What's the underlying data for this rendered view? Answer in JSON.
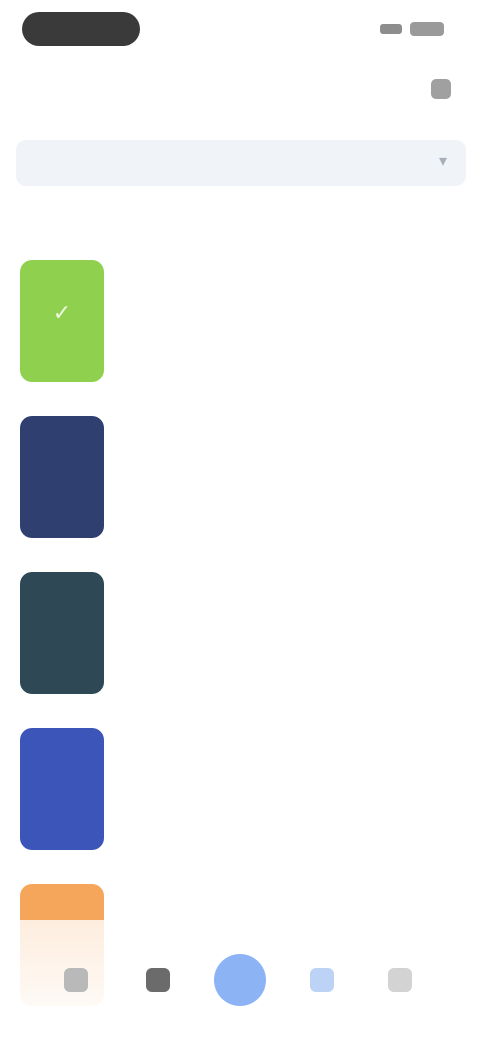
{
  "status_bar": {
    "pill": "",
    "signal_icon": "signal-icon",
    "battery_icon": "battery-icon"
  },
  "header": {
    "title": "",
    "menu_icon": "menu-icon"
  },
  "search": {
    "placeholder": "",
    "filter_icon": "filter-icon"
  },
  "sub_row": {
    "left_text": "",
    "right_link": ""
  },
  "list": {
    "items": [
      {
        "title": "",
        "subtitle": "",
        "cover_color": "#8fd14f",
        "cover_glyph": "✓"
      },
      {
        "title": "",
        "subtitle": "",
        "cover_color": "#2f3f6f",
        "cover_glyph": ""
      },
      {
        "title": "",
        "subtitle": "",
        "cover_color": "#2e4955",
        "cover_glyph": ""
      },
      {
        "title": "",
        "subtitle": "",
        "cover_color": "#3c55b8",
        "cover_glyph": ""
      },
      {
        "title": "",
        "subtitle": "",
        "cover_color": "#f5a65b",
        "cover_glyph": ""
      }
    ]
  },
  "bottom_nav": {
    "items": [
      {
        "icon": "home-icon"
      },
      {
        "icon": "discover-icon"
      },
      {
        "icon": "add-icon",
        "active": true
      },
      {
        "icon": "library-icon"
      },
      {
        "icon": "profile-icon"
      }
    ]
  },
  "colors": {
    "accent": "#8cb4f5",
    "search_bg": "#f0f3f7",
    "link": "#86b2f0"
  }
}
